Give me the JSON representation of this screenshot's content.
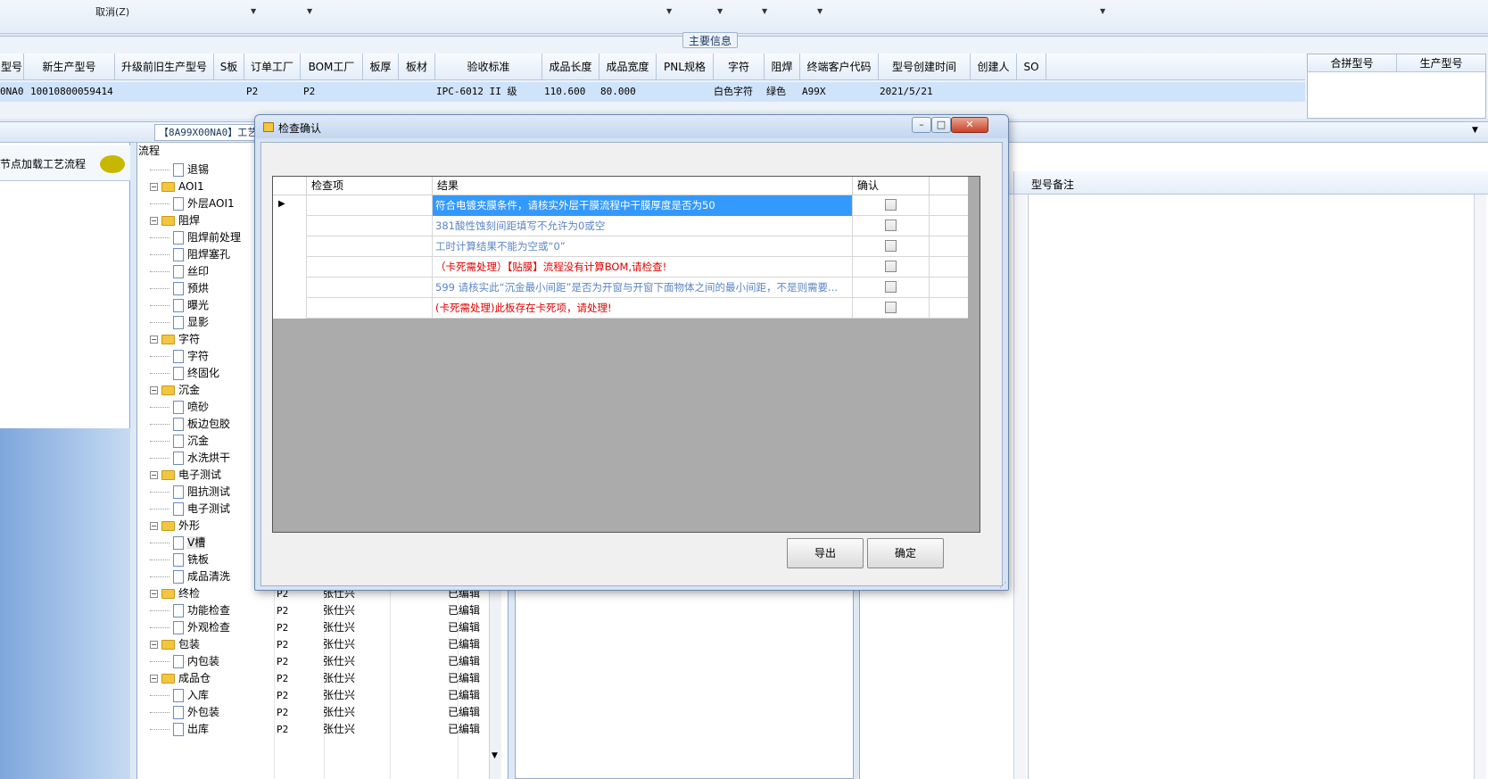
{
  "toolbar": {
    "cancel_label": "取消(Z)"
  },
  "main_info": {
    "legend": "主要信息",
    "headers": [
      "型号",
      "新生产型号",
      "升级前旧生产型号",
      "S板",
      "订单工厂",
      "BOM工厂",
      "板厚",
      "板材",
      "验收标准",
      "成品长度",
      "成品宽度",
      "PNL规格",
      "字符",
      "阻焊",
      "终端客户代码",
      "型号创建时间",
      "创建人",
      "SO"
    ],
    "row": {
      "model": "0NA0",
      "new_model": "10010800059414",
      "order_factory": "P2",
      "bom_factory": "P2",
      "standard": "IPC-6012 II 级",
      "length": "110.600",
      "width": "80.000",
      "char": "白色字符",
      "mask": "绿色",
      "customer_code": "A99X",
      "created": "2021/5/21"
    },
    "right_headers": [
      "合拼型号",
      "生产型号"
    ]
  },
  "route_tab": "【8A99X00NA0】工艺",
  "left_panel": {
    "title": "节点加载工艺流程"
  },
  "tree": {
    "title": "流程",
    "items": [
      {
        "label": "退锡",
        "level": 1
      },
      {
        "label": "AOI1",
        "level": 0
      },
      {
        "label": "外层AOI1",
        "level": 1
      },
      {
        "label": "阻焊",
        "level": 0
      },
      {
        "label": "阻焊前处理",
        "level": 1
      },
      {
        "label": "阻焊塞孔",
        "level": 1
      },
      {
        "label": "丝印",
        "level": 1
      },
      {
        "label": "预烘",
        "level": 1
      },
      {
        "label": "曝光",
        "level": 1
      },
      {
        "label": "显影",
        "level": 1
      },
      {
        "label": "字符",
        "level": 0
      },
      {
        "label": "字符",
        "level": 1
      },
      {
        "label": "终固化",
        "level": 1
      },
      {
        "label": "沉金",
        "level": 0
      },
      {
        "label": "喷砂",
        "level": 1
      },
      {
        "label": "板边包胶",
        "level": 1
      },
      {
        "label": "沉金",
        "level": 1
      },
      {
        "label": "水洗烘干",
        "level": 1
      },
      {
        "label": "电子测试",
        "level": 0
      },
      {
        "label": "阻抗测试",
        "level": 1
      },
      {
        "label": "电子测试",
        "level": 1
      },
      {
        "label": "外形",
        "level": 0
      },
      {
        "label": "V槽",
        "level": 1
      },
      {
        "label": "铣板",
        "level": 1
      },
      {
        "label": "成品清洗",
        "level": 1
      },
      {
        "label": "终检",
        "level": 0,
        "factory": "P2",
        "person": "张仕兴",
        "status": "已编辑"
      },
      {
        "label": "功能检查",
        "level": 1,
        "factory": "P2",
        "person": "张仕兴",
        "status": "已编辑"
      },
      {
        "label": "外观检查",
        "level": 1,
        "factory": "P2",
        "person": "张仕兴",
        "status": "已编辑"
      },
      {
        "label": "包装",
        "level": 0,
        "factory": "P2",
        "person": "张仕兴",
        "status": "已编辑"
      },
      {
        "label": "内包装",
        "level": 1,
        "factory": "P2",
        "person": "张仕兴",
        "status": "已编辑"
      },
      {
        "label": "成品仓",
        "level": 0,
        "factory": "P2",
        "person": "张仕兴",
        "status": "已编辑"
      },
      {
        "label": "入库",
        "level": 1,
        "factory": "P2",
        "person": "张仕兴",
        "status": "已编辑"
      },
      {
        "label": "外包装",
        "level": 1,
        "factory": "P2",
        "person": "张仕兴",
        "status": "已编辑"
      },
      {
        "label": "出库",
        "level": 1,
        "factory": "P2",
        "person": "张仕兴",
        "status": "已编辑"
      }
    ]
  },
  "right_panel": {
    "remark_header": "型号备注"
  },
  "dialog": {
    "title": "检查确认",
    "columns": {
      "check_item": "检查项",
      "result": "结果",
      "confirm": "确认"
    },
    "rows": [
      {
        "item": "",
        "result": "符合电镀夹膜条件，请核实外层干膜流程中干膜厚度是否为50",
        "color": "#ffffff",
        "selected": true
      },
      {
        "item": "",
        "result": "381酸性蚀刻间距填写不允许为0或空",
        "color": "#5a86c5",
        "selected": false
      },
      {
        "item": "",
        "result": "工时计算结果不能为空或“0”",
        "color": "#5a86c5",
        "selected": false
      },
      {
        "item": "",
        "result": "（卡死需处理）【贴膜】流程没有计算BOM,请检查!",
        "color": "#e00000",
        "selected": false
      },
      {
        "item": "",
        "result": "599 请核实此“沉金最小间距”是否为开窗与开窗下面物体之间的最小间距，不是则需要...",
        "color": "#5a86c5",
        "selected": false
      },
      {
        "item": "",
        "result": "(卡死需处理)此板存在卡死项，请处理!",
        "color": "#e00000",
        "selected": false
      }
    ],
    "export_label": "导出",
    "ok_label": "确定"
  }
}
